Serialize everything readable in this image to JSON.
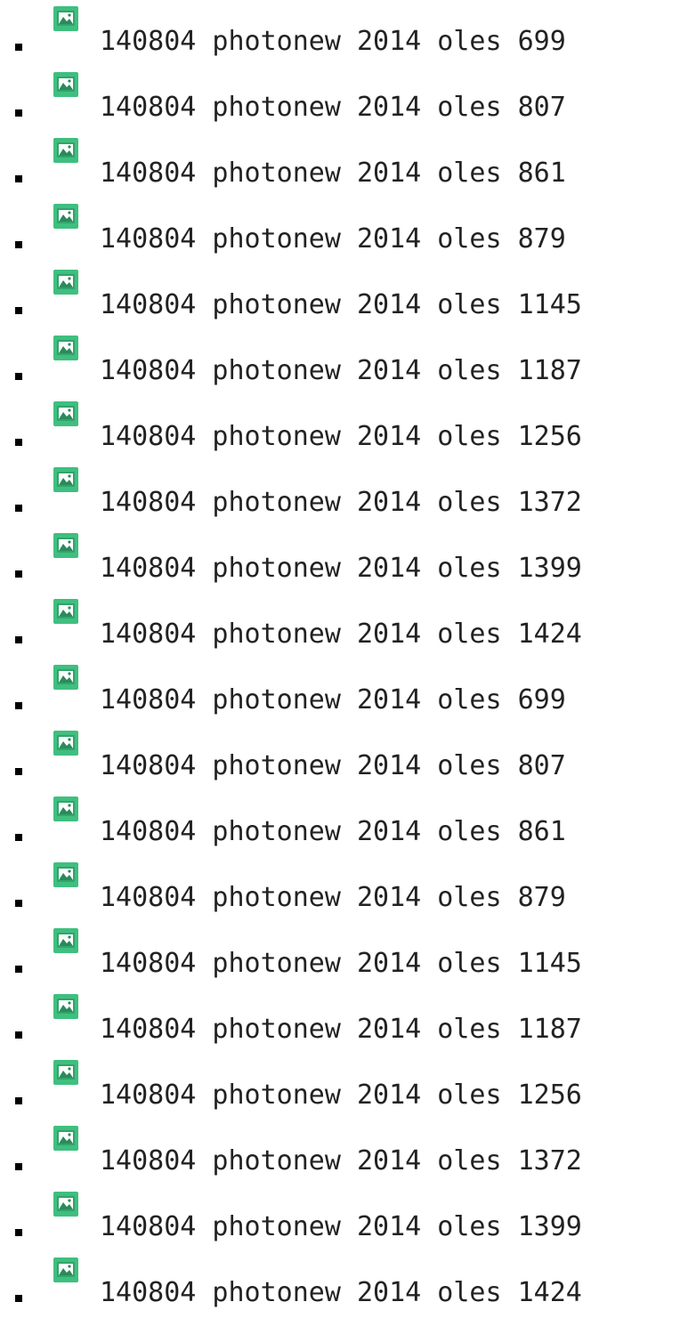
{
  "icon": {
    "name": "image-file-icon",
    "colors": {
      "fill": "#3fbf7f",
      "dark": "#2e9d66",
      "inner": "#ffffff",
      "landscape": "#2a8a5a"
    }
  },
  "files": [
    {
      "label": "140804 photonew 2014 oles 699"
    },
    {
      "label": "140804 photonew 2014 oles 807"
    },
    {
      "label": "140804 photonew 2014 oles 861"
    },
    {
      "label": "140804 photonew 2014 oles 879"
    },
    {
      "label": "140804 photonew 2014 oles 1145"
    },
    {
      "label": "140804 photonew 2014 oles 1187"
    },
    {
      "label": "140804 photonew 2014 oles 1256"
    },
    {
      "label": "140804 photonew 2014 oles 1372"
    },
    {
      "label": "140804 photonew 2014 oles 1399"
    },
    {
      "label": "140804 photonew 2014 oles 1424"
    },
    {
      "label": "140804 photonew 2014 oles 699"
    },
    {
      "label": "140804 photonew 2014 oles 807"
    },
    {
      "label": "140804 photonew 2014 oles 861"
    },
    {
      "label": "140804 photonew 2014 oles 879"
    },
    {
      "label": "140804 photonew 2014 oles 1145"
    },
    {
      "label": "140804 photonew 2014 oles 1187"
    },
    {
      "label": "140804 photonew 2014 oles 1256"
    },
    {
      "label": "140804 photonew 2014 oles 1372"
    },
    {
      "label": "140804 photonew 2014 oles 1399"
    },
    {
      "label": "140804 photonew 2014 oles 1424"
    }
  ]
}
